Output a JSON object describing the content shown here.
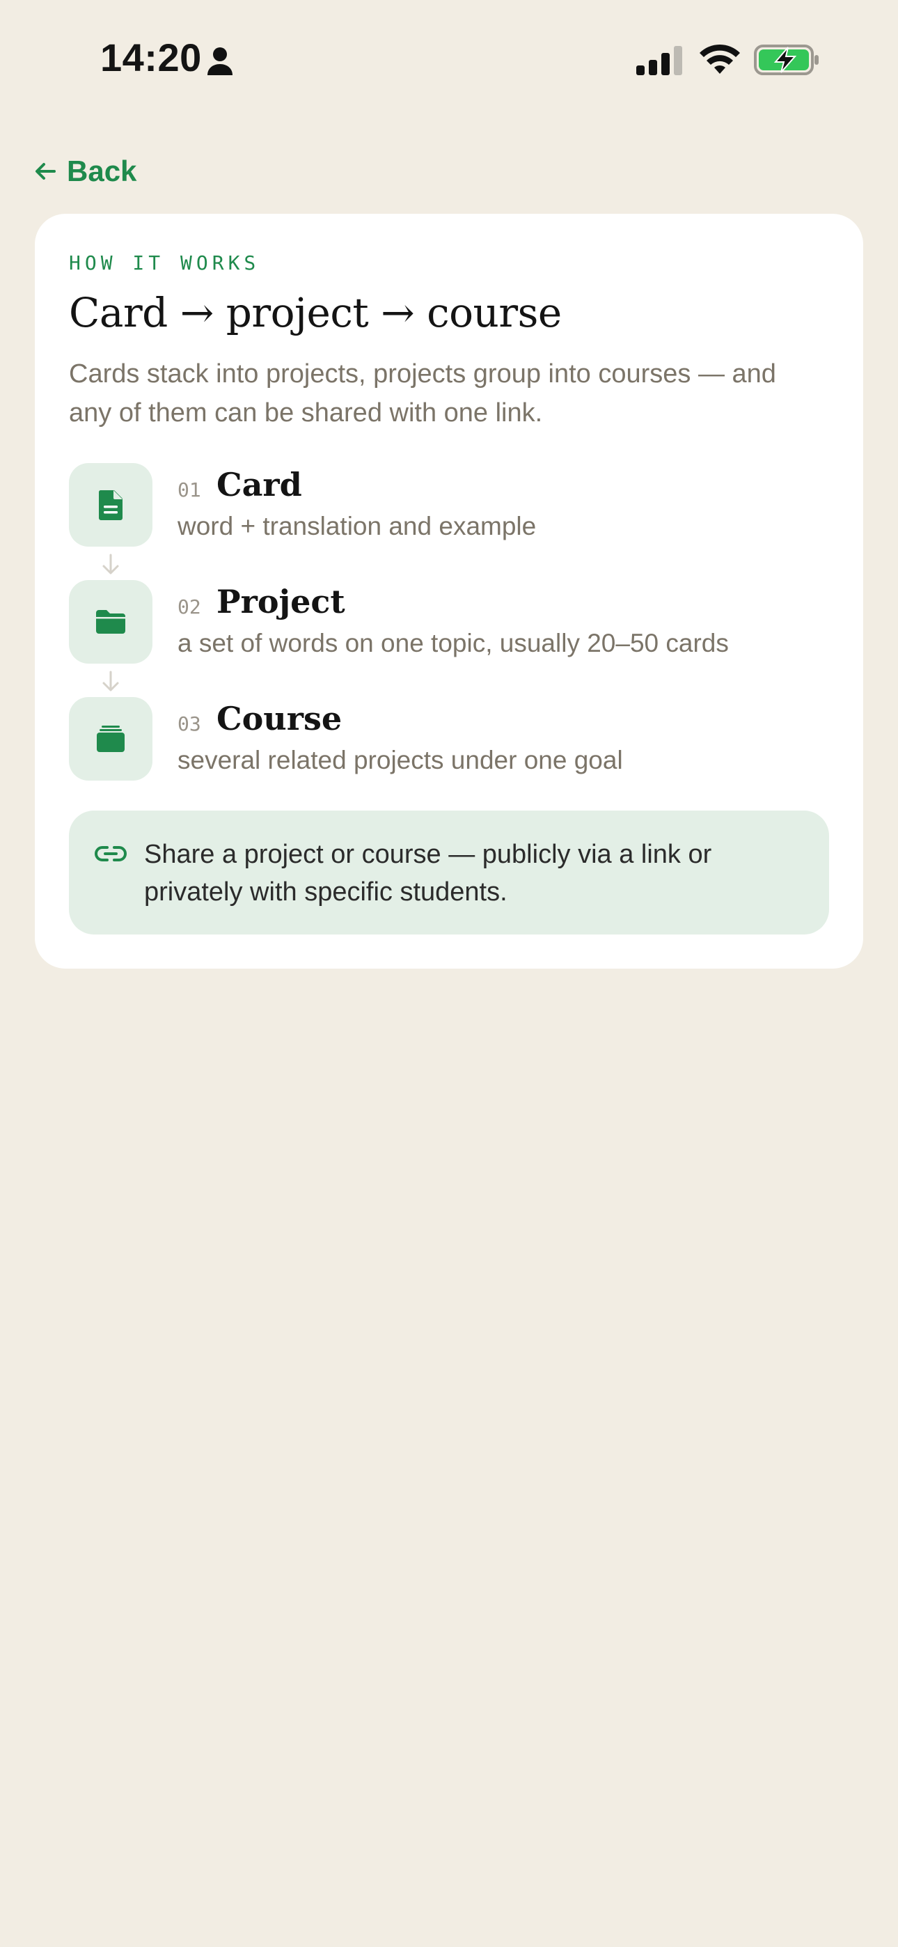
{
  "status": {
    "time": "14:20"
  },
  "nav": {
    "back_label": "Back"
  },
  "card": {
    "eyebrow": "HOW IT WORKS",
    "title": "Card → project → course",
    "description": "Cards stack into projects, projects group into courses — and any of them can be shared with one link.",
    "steps": [
      {
        "number": "01",
        "name": "Card",
        "subtitle": "word + translation and example",
        "icon": "document-icon"
      },
      {
        "number": "02",
        "name": "Project",
        "subtitle": "a set of words on one topic, usually 20–50 cards",
        "icon": "folder-icon"
      },
      {
        "number": "03",
        "name": "Course",
        "subtitle": "several related projects under one goal",
        "icon": "stack-icon"
      }
    ],
    "share_note": "Share a project or course — publicly via a link or privately with specific students."
  },
  "colors": {
    "accent": "#1f8a4c",
    "accent_soft": "#e3efe6",
    "background": "#f2ede3"
  }
}
